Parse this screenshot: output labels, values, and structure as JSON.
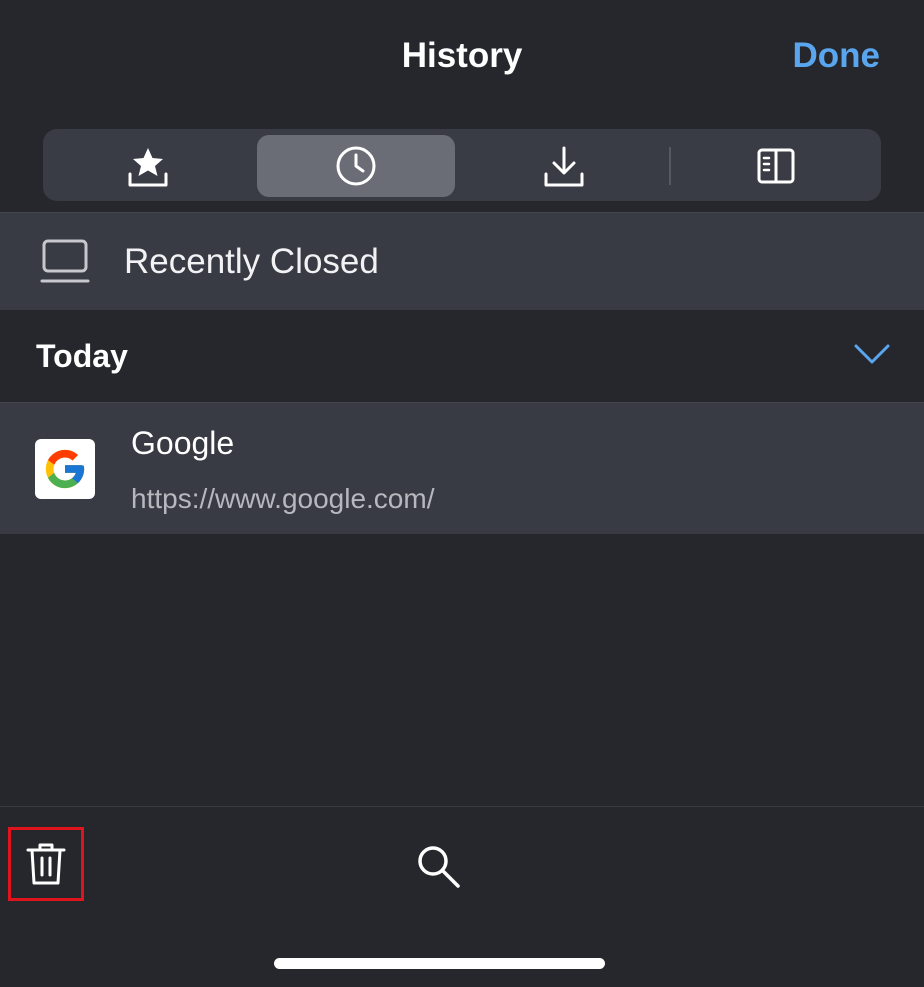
{
  "header": {
    "title": "History",
    "done_label": "Done"
  },
  "tabs": [
    {
      "name": "bookmarks",
      "icon": "star-tray-icon",
      "active": false
    },
    {
      "name": "history",
      "icon": "clock-icon",
      "active": true
    },
    {
      "name": "downloads",
      "icon": "download-icon",
      "active": false
    },
    {
      "name": "reading-list",
      "icon": "reading-list-icon",
      "active": false
    }
  ],
  "recently_closed": {
    "label": "Recently Closed",
    "icon": "laptop-icon"
  },
  "section": {
    "label": "Today",
    "icon": "chevron-down-icon"
  },
  "history_items": [
    {
      "title": "Google",
      "url": "https://www.google.com/",
      "icon": "google-favicon-icon"
    }
  ],
  "toolbar": {
    "trash_icon": "trash-icon",
    "search_icon": "search-icon"
  },
  "colors": {
    "accent": "#5aa6ee",
    "background": "#26272c",
    "row_background": "#383a44",
    "highlight_border": "#e0141d"
  }
}
